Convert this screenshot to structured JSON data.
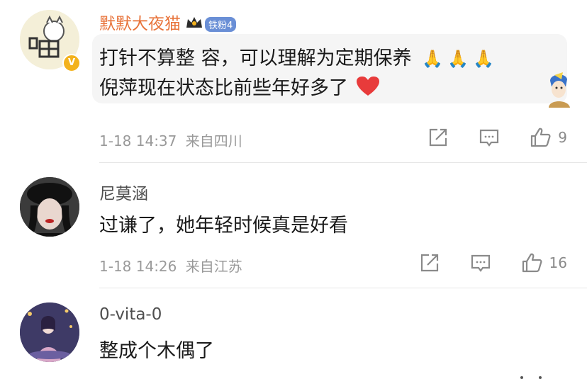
{
  "comments": [
    {
      "username": "默默大夜猫",
      "fan_badge": "铁粉4",
      "text_line1": "打针不算整 容，可以理解为定期保养",
      "text_line2": "倪萍现在状态比前些年好多了",
      "time": "1-18 14:37",
      "location": "来自四川",
      "likes": "9"
    },
    {
      "username": "尼莫涵",
      "text_line1": "过谦了，她年轻时候真是好看",
      "time": "1-18 14:26",
      "location": "来自江苏",
      "likes": "16"
    },
    {
      "username": "0-vita-0",
      "text_line1": "整成个木偶了"
    }
  ],
  "icons": {
    "share": "share-icon",
    "comment": "comment-icon",
    "like": "thumbs-up-icon",
    "emoji_prayer": "prayer-emoji",
    "emoji_heart": "heart-emoji",
    "verified": "verified-badge-icon"
  },
  "colors": {
    "vip_name": "#e8733a",
    "meta": "#9a9a9a",
    "heart": "#e83b3b",
    "highlight_bg": "#f5f5f5"
  }
}
